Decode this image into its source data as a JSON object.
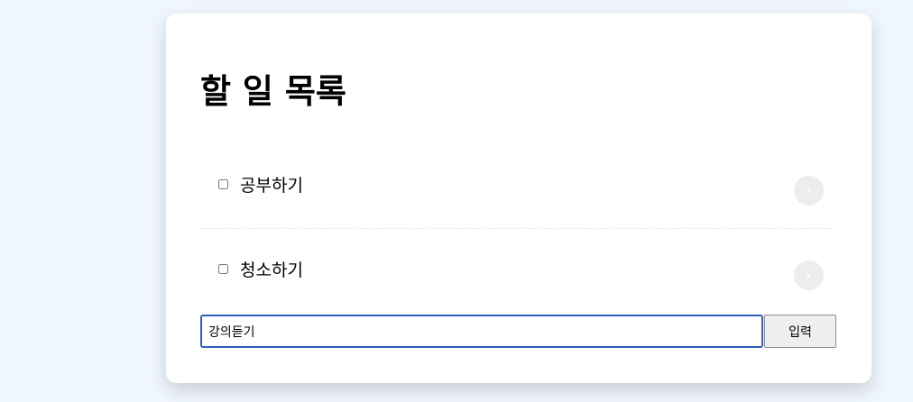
{
  "app": {
    "title": "할 일 목록"
  },
  "todos": [
    {
      "text": "공부하기",
      "checked": false,
      "delete_label": "x"
    },
    {
      "text": "청소하기",
      "checked": false,
      "delete_label": "x"
    }
  ],
  "input": {
    "value": "강의듣기",
    "placeholder": ""
  },
  "submit": {
    "label": "입력"
  },
  "colors": {
    "background": "#f0f6fd",
    "card": "#ffffff",
    "input_border": "#2f5ebd",
    "delete_button": "#ededed"
  }
}
